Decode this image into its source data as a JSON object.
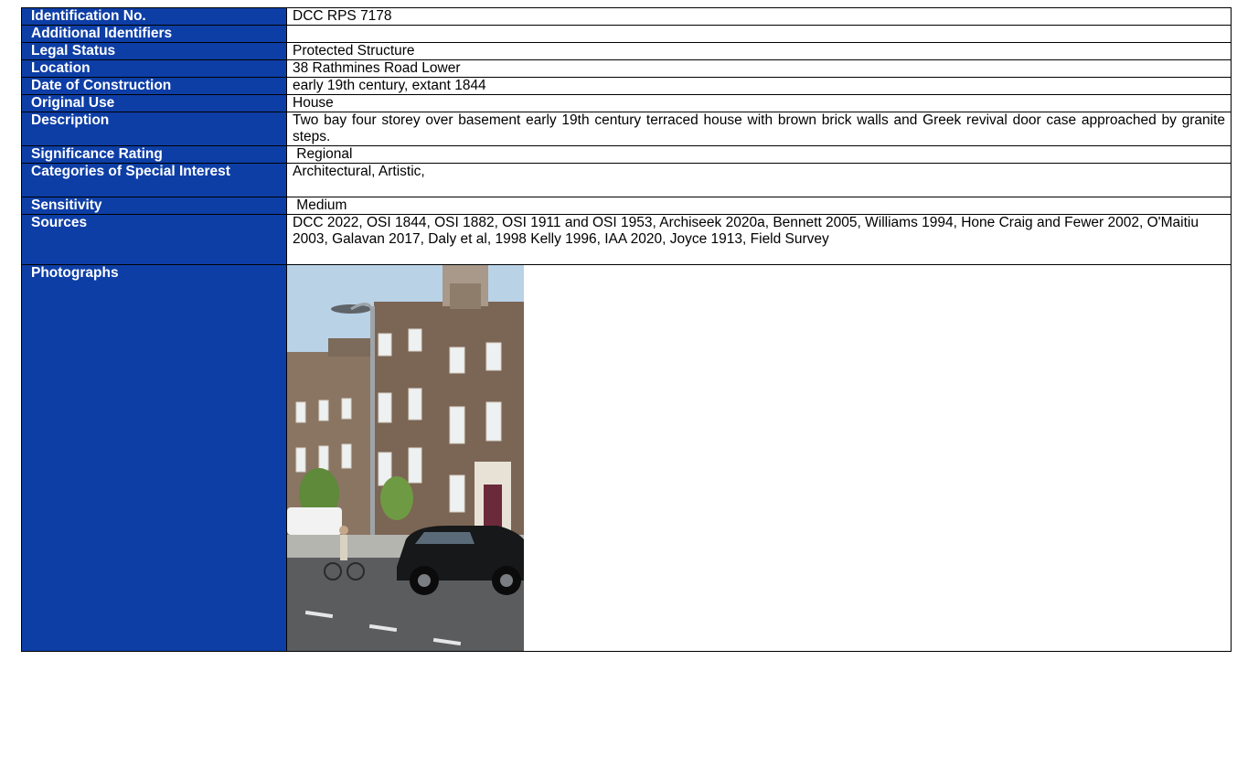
{
  "rows": [
    {
      "label": "Identification No.",
      "value": "DCC RPS 7178"
    },
    {
      "label": "Additional Identifiers",
      "value": ""
    },
    {
      "label": "Legal Status",
      "value": "Protected Structure"
    },
    {
      "label": "Location",
      "value": "38 Rathmines Road Lower"
    },
    {
      "label": "Date of Construction",
      "value": "early 19th century, extant 1844"
    },
    {
      "label": "Original Use",
      "value": "House"
    },
    {
      "label": "Description",
      "value": "Two bay four storey over basement early 19th century terraced house with brown brick walls and Greek revival door case approached by granite steps."
    },
    {
      "label": "Significance Rating",
      "value": " Regional"
    },
    {
      "label": "Categories of Special Interest",
      "value": "Architectural, Artistic,"
    },
    {
      "label": "Sensitivity",
      "value": " Medium"
    },
    {
      "label": "Sources",
      "value": "DCC 2022, OSI 1844, OSI 1882, OSI 1911 and OSI 1953, Archiseek 2020a, Bennett 2005, Williams 1994, Hone Craig and Fewer 2002, O'Maitiu 2003, Galavan 2017, Daly et al, 1998 Kelly 1996, IAA 2020, Joyce 1913, Field Survey"
    },
    {
      "label": "Photographs",
      "value": ""
    }
  ],
  "colors": {
    "header_bg": "#0d3ea6",
    "header_text": "#ffffff"
  },
  "photo_icon": "terraced-house-street-photo"
}
